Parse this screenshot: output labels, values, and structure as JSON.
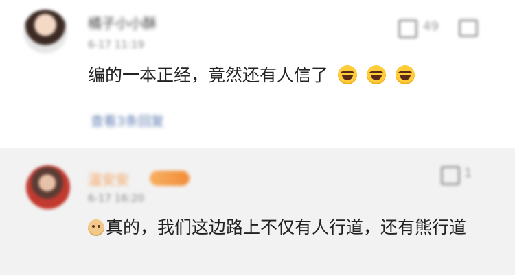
{
  "comments": [
    {
      "username": "橘子小小酥",
      "timestamp": "6-17 11:19",
      "text": "编的一本正经，竟然还有人信了",
      "emojis": [
        "laughing-crying-icon",
        "laughing-crying-icon",
        "laughing-crying-icon"
      ],
      "like_count": "49",
      "reply_link": "查看3条回复"
    },
    {
      "username": "温安安",
      "timestamp": "6-17 16:20",
      "badge": "会员",
      "emoji": "doge-icon",
      "text": "真的，我们这边路上不仅有人行道，还有熊行道",
      "like_count": "1"
    }
  ],
  "colors": {
    "comment_bg": "#ffffff",
    "reply_bg": "#f2f2f2",
    "link_blue": "#5f7eb2",
    "name_orange": "#f4a05a",
    "text": "#222222",
    "muted": "#8a8a8a"
  }
}
